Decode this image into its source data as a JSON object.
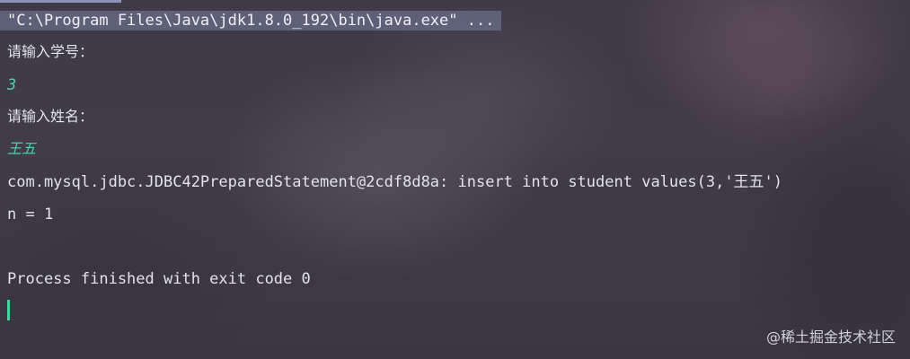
{
  "console": {
    "command": "\"C:\\Program Files\\Java\\jdk1.8.0_192\\bin\\java.exe\" ...",
    "prompt_id": "请输入学号：",
    "input_id": "3",
    "prompt_name": "请输入姓名：",
    "input_name": "王五",
    "statement": "com.mysql.jdbc.JDBC42PreparedStatement@2cdf8d8a: insert into student values(3,'王五')",
    "result": "n = 1",
    "exit": "Process finished with exit code 0"
  },
  "watermark": "@稀土掘金技术社区",
  "colors": {
    "input_text": "#4fd1a8",
    "cursor": "#3fd6a0",
    "command_highlight": "#78809f"
  }
}
